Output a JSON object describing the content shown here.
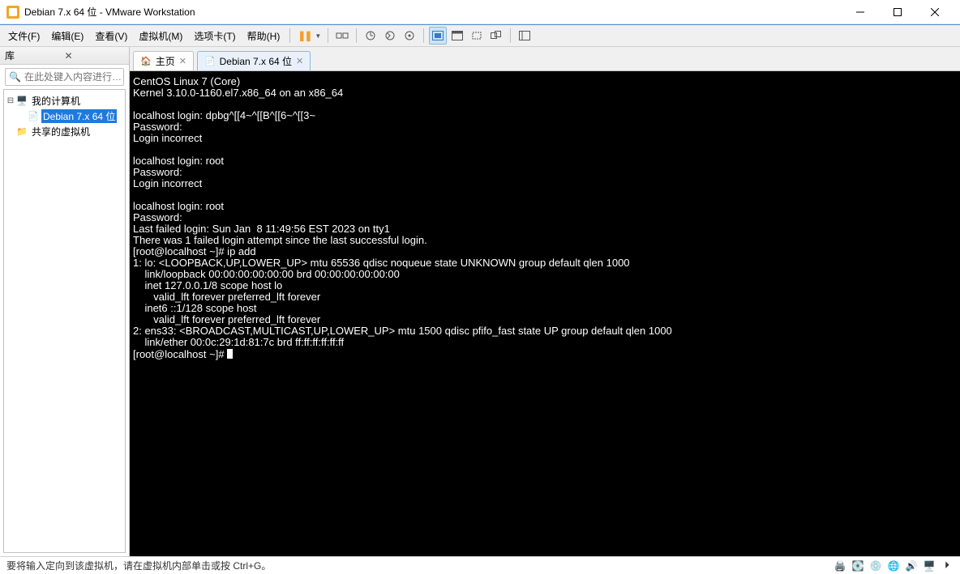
{
  "titlebar": {
    "title": "Debian 7.x 64 位 - VMware Workstation"
  },
  "menu": {
    "file": "文件(F)",
    "edit": "编辑(E)",
    "view": "查看(V)",
    "vm": "虚拟机(M)",
    "tabs": "选项卡(T)",
    "help": "帮助(H)"
  },
  "sidebar": {
    "title": "库",
    "search_placeholder": "在此处键入内容进行…",
    "tree": {
      "root": "我的计算机",
      "vm": "Debian 7.x 64 位",
      "shared": "共享的虚拟机"
    }
  },
  "tabs": {
    "home": "主页",
    "vm": "Debian 7.x 64 位"
  },
  "terminal": {
    "line01": "CentOS Linux 7 (Core)",
    "line02": "Kernel 3.10.0-1160.el7.x86_64 on an x86_64",
    "line03": "",
    "line04": "localhost login: dpbg^[[4~^[[B^[[6~^[[3~",
    "line05": "Password:",
    "line06": "Login incorrect",
    "line07": "",
    "line08": "localhost login: root",
    "line09": "Password:",
    "line10": "Login incorrect",
    "line11": "",
    "line12": "localhost login: root",
    "line13": "Password:",
    "line14": "Last failed login: Sun Jan  8 11:49:56 EST 2023 on tty1",
    "line15": "There was 1 failed login attempt since the last successful login.",
    "line16": "[root@localhost ~]# ip add",
    "line17": "1: lo: <LOOPBACK,UP,LOWER_UP> mtu 65536 qdisc noqueue state UNKNOWN group default qlen 1000",
    "line18": "    link/loopback 00:00:00:00:00:00 brd 00:00:00:00:00:00",
    "line19": "    inet 127.0.0.1/8 scope host lo",
    "line20": "       valid_lft forever preferred_lft forever",
    "line21": "    inet6 ::1/128 scope host",
    "line22": "       valid_lft forever preferred_lft forever",
    "line23": "2: ens33: <BROADCAST,MULTICAST,UP,LOWER_UP> mtu 1500 qdisc pfifo_fast state UP group default qlen 1000",
    "line24": "    link/ether 00:0c:29:1d:81:7c brd ff:ff:ff:ff:ff:ff",
    "line25": "[root@localhost ~]# "
  },
  "statusbar": {
    "text": "要将输入定向到该虚拟机，请在虚拟机内部单击或按 Ctrl+G。"
  }
}
